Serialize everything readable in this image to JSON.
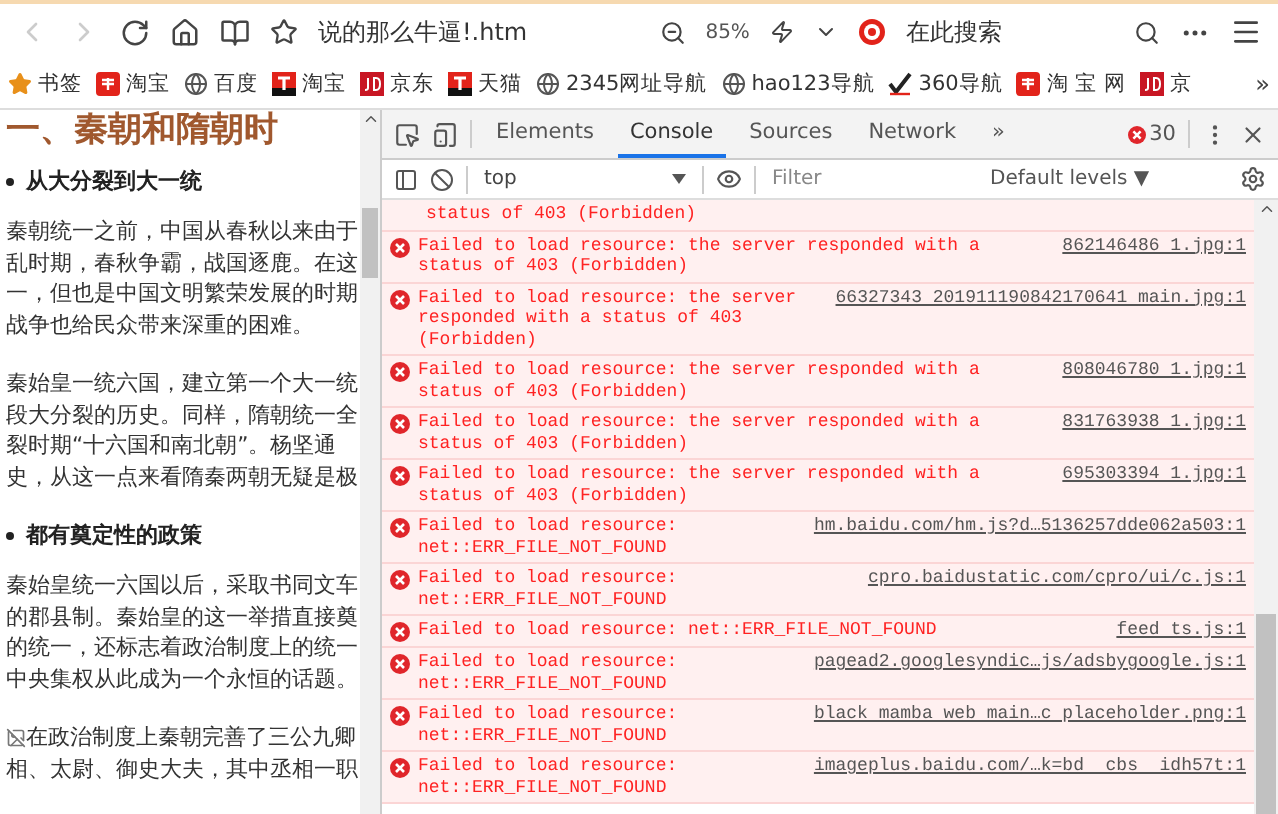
{
  "toolbar": {
    "address": "说的那么牛逼!.htm",
    "zoom": "85%",
    "search_placeholder": "在此搜索"
  },
  "bookmarks": [
    {
      "kind": "star",
      "label": "书签"
    },
    {
      "kind": "taobao",
      "label": "淘宝"
    },
    {
      "kind": "globe",
      "label": "百度"
    },
    {
      "kind": "tmall",
      "label": "淘宝"
    },
    {
      "kind": "jd",
      "label": "京东"
    },
    {
      "kind": "tmall",
      "label": "天猫"
    },
    {
      "kind": "globe",
      "label": "2345网址导航"
    },
    {
      "kind": "globe",
      "label": "hao123导航"
    },
    {
      "kind": "check",
      "label": "360导航"
    },
    {
      "kind": "taobao",
      "label": "淘 宝 网"
    },
    {
      "kind": "jd",
      "label": "京"
    }
  ],
  "bookmarks_more": "»",
  "page": {
    "heading": "一、秦朝和隋朝时",
    "blocks": [
      {
        "kind": "bullet",
        "text": "从大分裂到大一统"
      },
      {
        "kind": "paragraph",
        "lines": [
          "秦朝统一之前，中国从春秋以来由于",
          "乱时期，春秋争霸，战国逐鹿。在这",
          "一，但也是中国文明繁荣发展的时期",
          "战争也给民众带来深重的困难。"
        ]
      },
      {
        "kind": "paragraph",
        "lines": [
          "秦始皇一统六国，建立第一个大一统",
          "段大分裂的历史。同样，隋朝统一全",
          "裂时期“十六国和南北朝”。杨坚通",
          "史，从这一点来看隋秦两朝无疑是极"
        ]
      },
      {
        "kind": "bullet",
        "text": "都有奠定性的政策"
      },
      {
        "kind": "paragraph",
        "lines": [
          "秦始皇统一六国以后，采取书同文车",
          "的郡县制。秦始皇的这一举措直接奠",
          "的统一，还标志着政治制度上的统一",
          "中央集权从此成为一个永恒的话题。"
        ]
      },
      {
        "kind": "image",
        "lines": [
          "在政治制度上秦朝完善了三公九卿",
          "相、太尉、御史大夫，其中丞相一职"
        ]
      }
    ]
  },
  "devtools": {
    "tabs": [
      {
        "label": "Elements",
        "selected": false
      },
      {
        "label": "Console",
        "selected": true
      },
      {
        "label": "Sources",
        "selected": false
      },
      {
        "label": "Network",
        "selected": false
      }
    ],
    "tabs_more": "»",
    "error_count": "30",
    "context": "top",
    "filter_placeholder": "Filter",
    "levels": "Default levels ▼",
    "messages": [
      {
        "kind": "continued",
        "text": "status of 403 (Forbidden)"
      },
      {
        "kind": "error",
        "text": "Failed to load resource: the server responded with a status of 403 (Forbidden)",
        "source": "862146486 1.jpg:1"
      },
      {
        "kind": "error",
        "text": "Failed to load resource: the server responded with a status of 403 (Forbidden)",
        "source": "66327343 201911190842170641 main.jpg:1"
      },
      {
        "kind": "error",
        "text": "Failed to load resource: the server responded with a status of 403 (Forbidden)",
        "source": "808046780 1.jpg:1"
      },
      {
        "kind": "error",
        "text": "Failed to load resource: the server responded with a status of 403 (Forbidden)",
        "source": "831763938 1.jpg:1"
      },
      {
        "kind": "error",
        "text": "Failed to load resource: the server responded with a status of 403 (Forbidden)",
        "source": "695303394 1.jpg:1"
      },
      {
        "kind": "error",
        "text": "Failed to load resource: net::ERR_FILE_NOT_FOUND",
        "source": "hm.baidu.com/hm.js?d…5136257dde062a503:1"
      },
      {
        "kind": "error",
        "text": "Failed to load resource: net::ERR_FILE_NOT_FOUND",
        "source": "cpro.baidustatic.com/cpro/ui/c.js:1"
      },
      {
        "kind": "error",
        "text": "Failed to load resource: net::ERR_FILE_NOT_FOUND",
        "source": "feed ts.js:1"
      },
      {
        "kind": "error",
        "text": "Failed to load resource: net::ERR_FILE_NOT_FOUND",
        "source": "pagead2.googlesyndic…js/adsbygoogle.js:1"
      },
      {
        "kind": "error",
        "text": "Failed to load resource: net::ERR_FILE_NOT_FOUND",
        "source": "black mamba web main…c placeholder.png:1"
      },
      {
        "kind": "error",
        "text": "Failed to load resource: net::ERR_FILE_NOT_FOUND",
        "source": "imageplus.baidu.com/…k=bd  cbs  idh57t:1"
      }
    ]
  }
}
